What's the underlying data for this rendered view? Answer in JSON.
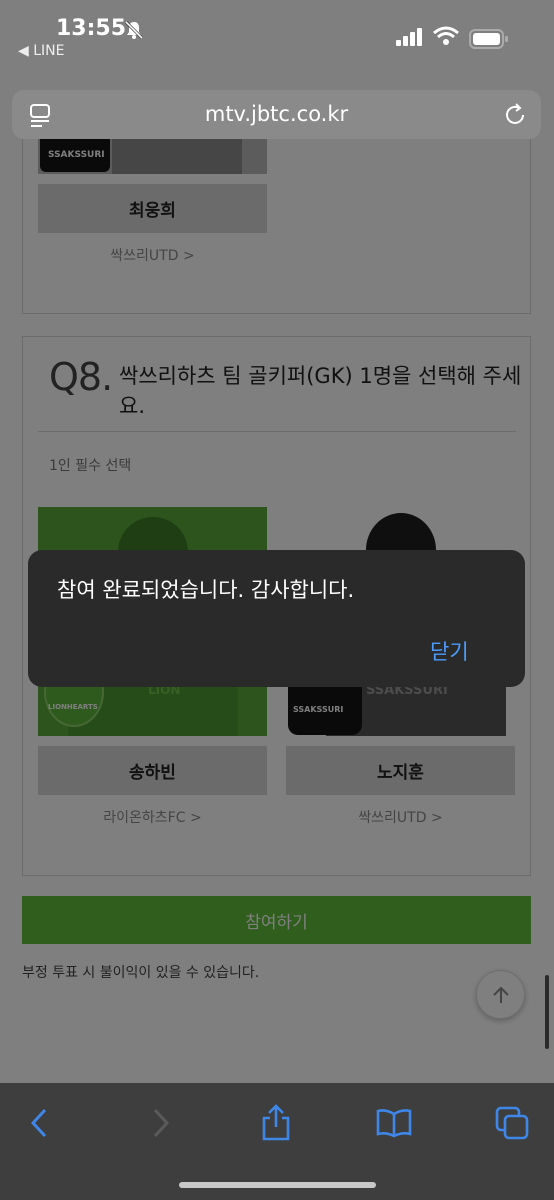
{
  "status_bar": {
    "time": "13:55",
    "back_app": "◀ LINE"
  },
  "browser": {
    "url": "mtv.jbtc.co.kr"
  },
  "previous_card": {
    "player_name": "최웅희",
    "team_link": "싹쓰리UTD >"
  },
  "question": {
    "number": "Q8.",
    "text": "싹쓰리하츠 팀 골키퍼(GK) 1명을 선택해 주세요.",
    "note": "1인 필수 선택",
    "candidates": [
      {
        "name": "송하빈",
        "team": "라이온하츠FC >",
        "logo_text": "LIONHEARTS",
        "shirt_text": "LION"
      },
      {
        "name": "노지훈",
        "team": "싹쓰리UTD >",
        "logo_text": "SSAKSSURI",
        "shirt_text": "SSAKSSURI"
      }
    ]
  },
  "top_thumb_logo": "SSAKSSURI",
  "submit_label": "참여하기",
  "warning": "부정 투표 시 불이익이 있을 수 있습니다.",
  "alert": {
    "message": "참여 완료되었습니다. 감사합니다.",
    "close_label": "닫기"
  },
  "colors": {
    "accent_green": "#5fbd3a",
    "alert_link": "#4a9cff",
    "alert_bg": "#2a2a2a"
  },
  "toolbar_icons": [
    "back-icon",
    "forward-icon",
    "share-icon",
    "bookmarks-icon",
    "tabs-icon"
  ]
}
